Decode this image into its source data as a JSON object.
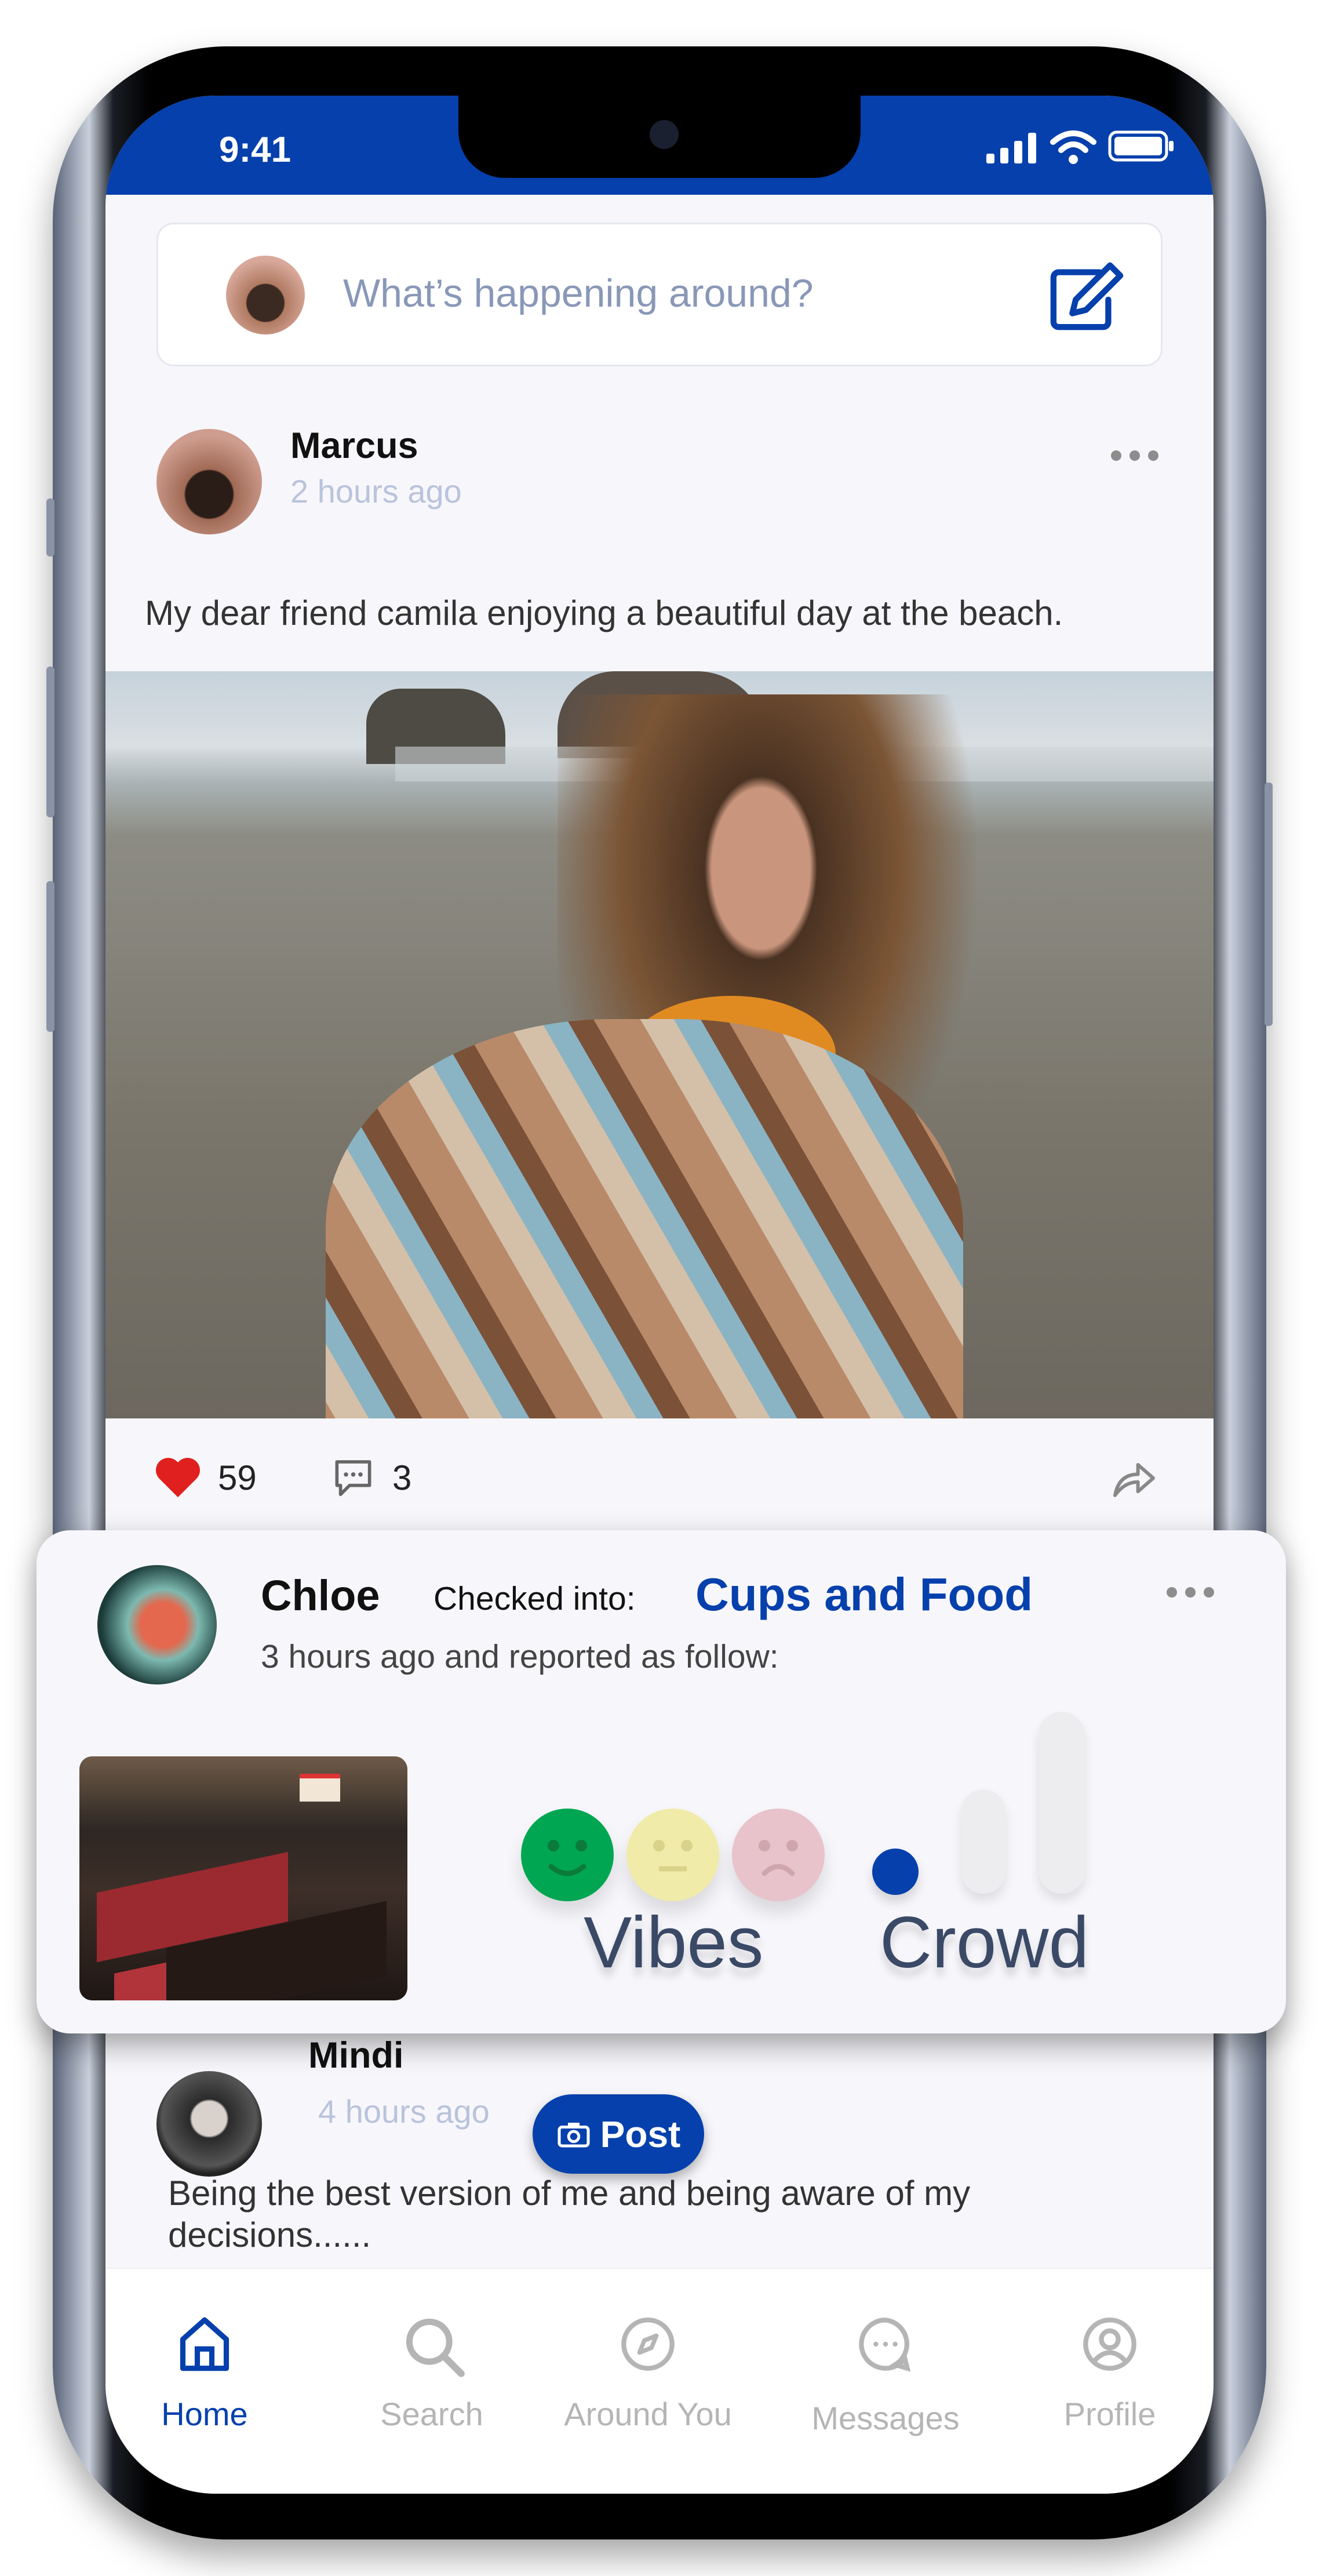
{
  "status_bar": {
    "time": "9:41"
  },
  "composer": {
    "placeholder": "What’s happening around?",
    "icon": "edit-icon"
  },
  "posts": [
    {
      "author": "Marcus",
      "time": "2 hours ago",
      "text": "My dear friend camila enjoying a beautiful day at the beach.",
      "likes": "59",
      "comments": "3"
    },
    {
      "author": "Mindi",
      "time": "4 hours ago",
      "text_line1": "Being the best version of me and being aware of my",
      "text_line2": "decisions......"
    }
  ],
  "checkin": {
    "author": "Chloe",
    "checked_label": "Checked into:",
    "place": "Cups and Food",
    "subtitle": "3 hours ago and reported as follow:",
    "vibes_label": "Vibes",
    "crowd_label": "Crowd",
    "vibe_selected": "happy",
    "crowd_level": "low"
  },
  "post_button": {
    "label": "Post"
  },
  "nav": {
    "items": [
      {
        "label": "Home",
        "active": true
      },
      {
        "label": "Search"
      },
      {
        "label": "Around You"
      },
      {
        "label": "Messages"
      },
      {
        "label": "Profile"
      }
    ]
  },
  "colors": {
    "brand": "#0540ad",
    "like": "#e0201f",
    "happy": "#00a651",
    "neutral": "#f0eba8",
    "sad": "#e8c3cb",
    "inactive": "#b5b5b5"
  }
}
